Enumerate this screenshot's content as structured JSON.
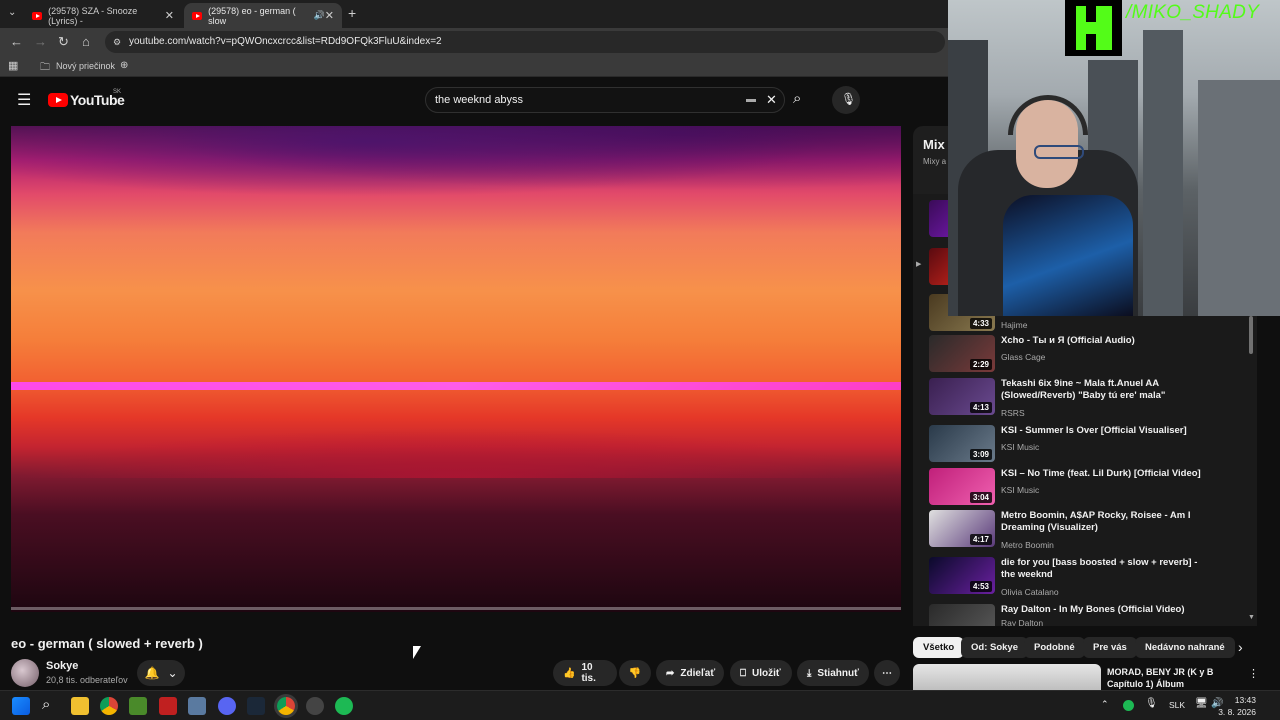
{
  "browser": {
    "tabs": [
      {
        "title": "(29578) SZA - Snooze (Lyrics) -"
      },
      {
        "title": "(29578) eo - german ( slow"
      }
    ],
    "url": "youtube.com/watch?v=pQWOncxcrcc&list=RDd9OFQk3FluU&index=2",
    "bookmark": "Nový priečinok"
  },
  "youtube": {
    "logo": "YouTube",
    "region": "SK",
    "search_value": "the weeknd abyss"
  },
  "video": {
    "title": "eo - german ( slowed + reverb )",
    "channel": "Sokye",
    "subscribers": "20,8 tis. odberateľov",
    "likes": "10 tis.",
    "share": "Zdieľať",
    "save": "Uložiť",
    "download": "Stiahnuť"
  },
  "sidebar": {
    "mix_title": "Mix",
    "mix_sub": "Mixy a",
    "partial_item": {
      "duration": "4:33",
      "channel": "Hajime"
    },
    "items": [
      {
        "title": "Xcho - Ты и Я (Official Audio)",
        "channel": "Glass Cage",
        "duration": "2:29"
      },
      {
        "title": "Tekashi 6ix 9ine ~ Mala ft.Anuel AA (Slowed/Reverb) \"Baby tú ere' mala\"",
        "channel": "RSRS",
        "duration": "4:13"
      },
      {
        "title": "KSI - Summer Is Over [Official Visualiser]",
        "channel": "KSI Music",
        "duration": "3:09"
      },
      {
        "title": "KSI – No Time (feat. Lil Durk) [Official Video]",
        "channel": "KSI Music",
        "duration": "3:04"
      },
      {
        "title": "Metro Boomin, A$AP Rocky, Roisee - Am I Dreaming (Visualizer)",
        "channel": "Metro Boomin",
        "duration": "4:17"
      },
      {
        "title": "die for you [bass boosted + slow + reverb] - the weeknd",
        "channel": "Olivia Catalano",
        "duration": "4:53"
      },
      {
        "title": "Ray Dalton - In My Bones (Official Video)",
        "channel": "Ray Dalton",
        "duration": ""
      }
    ],
    "chips": [
      "Všetko",
      "Od: Sokye",
      "Podobné",
      "Pre vás",
      "Nedávno nahrané"
    ],
    "next_title": "MORAD, BENY JR (K y B Capítulo 1) Álbum"
  },
  "overlay": {
    "handle": "/MIKO_SHADY"
  },
  "taskbar": {
    "lang": "SLK",
    "time": "13:43",
    "date": "3. 8. 2026"
  }
}
